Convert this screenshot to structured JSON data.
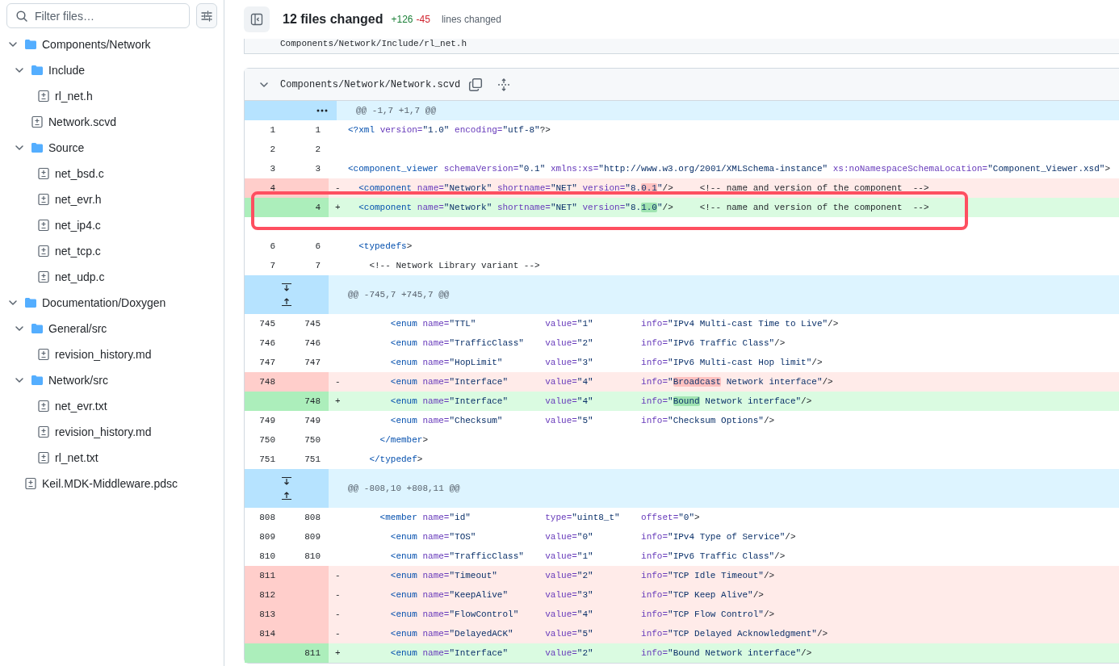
{
  "sidebar": {
    "filter": {
      "placeholder": "Filter files…"
    },
    "tree": [
      {
        "kind": "folder",
        "label": "Components/Network",
        "expanded": true,
        "children": [
          {
            "kind": "folder",
            "label": "Include",
            "expanded": true,
            "children": [
              {
                "kind": "file",
                "label": "rl_net.h"
              }
            ]
          },
          {
            "kind": "file",
            "label": "Network.scvd"
          },
          {
            "kind": "folder",
            "label": "Source",
            "expanded": true,
            "children": [
              {
                "kind": "file",
                "label": "net_bsd.c"
              },
              {
                "kind": "file",
                "label": "net_evr.h"
              },
              {
                "kind": "file",
                "label": "net_ip4.c"
              },
              {
                "kind": "file",
                "label": "net_tcp.c"
              },
              {
                "kind": "file",
                "label": "net_udp.c"
              }
            ]
          }
        ]
      },
      {
        "kind": "folder",
        "label": "Documentation/Doxygen",
        "expanded": true,
        "children": [
          {
            "kind": "folder",
            "label": "General/src",
            "expanded": true,
            "children": [
              {
                "kind": "file",
                "label": "revision_history.md"
              }
            ]
          },
          {
            "kind": "folder",
            "label": "Network/src",
            "expanded": true,
            "children": [
              {
                "kind": "file",
                "label": "net_evr.txt"
              },
              {
                "kind": "file",
                "label": "revision_history.md"
              },
              {
                "kind": "file",
                "label": "rl_net.txt"
              }
            ]
          }
        ]
      },
      {
        "kind": "file",
        "label": "Keil.MDK-Middleware.pdsc"
      }
    ]
  },
  "header": {
    "title": "12 files changed",
    "additions": "+126",
    "deletions": "-45",
    "suffix": "lines changed"
  },
  "previous_file": {
    "path": "Components/Network/Include/rl_net.h"
  },
  "file": {
    "path": "Components/Network/Network.scvd",
    "expanded": true,
    "lines": [
      {
        "kind": "hunk_top",
        "code": [
          [
            "@@ -1,7 +1,7 @@"
          ]
        ]
      },
      {
        "kind": "context",
        "old": "1",
        "new": "1",
        "code": [
          [
            "<?xml version=\"1.0\" encoding=\"utf-8\"?>"
          ]
        ]
      },
      {
        "kind": "context",
        "old": "2",
        "new": "2"
      },
      {
        "kind": "context",
        "old": "3",
        "new": "3",
        "code": [
          [
            "<component_viewer schemaVersion=\"0.1\" xmlns:xs=\"http://www.w3.org/2001/XMLSchema-instance\" xs:noNamespaceSchemaLocation=\"Component_Viewer.xsd\">"
          ]
        ]
      },
      {
        "kind": "del",
        "old": "4",
        "sign": "-",
        "code": [
          [
            "  <component name=\"Network\" shortname=\"NET\" version=\"8.",
            "0.1",
            "\"/>"
          ],
          [
            "<!-- name and version of the component  -->"
          ]
        ]
      },
      {
        "kind": "add",
        "new": "4",
        "sign": "+",
        "annotated": true,
        "code": [
          [
            "  <component name=\"Network\" shortname=\"NET\" version=\"8.",
            "1.0",
            "\"/>"
          ],
          [
            "<!-- name and version of the component  -->"
          ]
        ]
      },
      {
        "kind": "context"
      },
      {
        "kind": "context",
        "old": "6",
        "new": "6",
        "code": [
          [
            "  <typedefs>"
          ]
        ]
      },
      {
        "kind": "context",
        "old": "7",
        "new": "7",
        "code": [
          [
            "    <!-- Network Library variant -->"
          ]
        ]
      },
      {
        "kind": "hunk",
        "code": [
          [
            "@@ -745,7 +745,7 @@"
          ]
        ]
      },
      {
        "kind": "context",
        "old": "745",
        "new": "745",
        "code": [
          [
            "        <enum name=\"TTL\""
          ],
          [
            "value=\"1\""
          ],
          [
            "info=\"IPv4 Multi-cast Time to Live\"/>"
          ]
        ]
      },
      {
        "kind": "context",
        "old": "746",
        "new": "746",
        "code": [
          [
            "        <enum name=\"TrafficClass\""
          ],
          [
            "value=\"2\""
          ],
          [
            "info=\"IPv6 Traffic Class\"/>"
          ]
        ]
      },
      {
        "kind": "context",
        "old": "747",
        "new": "747",
        "code": [
          [
            "        <enum name=\"HopLimit\""
          ],
          [
            "value=\"3\""
          ],
          [
            "info=\"IPv6 Multi-cast Hop limit\"/>"
          ]
        ]
      },
      {
        "kind": "del",
        "old": "748",
        "sign": "-",
        "code": [
          [
            "        <enum name=\"Interface\""
          ],
          [
            "value=\"4\""
          ],
          [
            "info=\"",
            "Broadcast",
            " Network interface\"/>"
          ]
        ]
      },
      {
        "kind": "add",
        "new": "748",
        "sign": "+",
        "code": [
          [
            "        <enum name=\"Interface\""
          ],
          [
            "value=\"4\""
          ],
          [
            "info=\"",
            "Bound",
            " Network interface\"/>"
          ]
        ]
      },
      {
        "kind": "context",
        "old": "749",
        "new": "749",
        "code": [
          [
            "        <enum name=\"Checksum\""
          ],
          [
            "value=\"5\""
          ],
          [
            "info=\"Checksum Options\"/>"
          ]
        ]
      },
      {
        "kind": "context",
        "old": "750",
        "new": "750",
        "code": [
          [
            "      </member>"
          ]
        ]
      },
      {
        "kind": "context",
        "old": "751",
        "new": "751",
        "code": [
          [
            "    </typedef>"
          ]
        ]
      },
      {
        "kind": "hunk",
        "code": [
          [
            "@@ -808,10 +808,11 @@"
          ]
        ]
      },
      {
        "kind": "context",
        "old": "808",
        "new": "808",
        "code": [
          [
            "      <member name=\"id\""
          ],
          [
            "type=\"uint8_t\""
          ],
          [
            "offset=\"0\">"
          ]
        ]
      },
      {
        "kind": "context",
        "old": "809",
        "new": "809",
        "code": [
          [
            "        <enum name=\"TOS\""
          ],
          [
            "value=\"0\""
          ],
          [
            "info=\"IPv4 Type of Service\"/>"
          ]
        ]
      },
      {
        "kind": "context",
        "old": "810",
        "new": "810",
        "code": [
          [
            "        <enum name=\"TrafficClass\""
          ],
          [
            "value=\"1\""
          ],
          [
            "info=\"IPv6 Traffic Class\"/>"
          ]
        ]
      },
      {
        "kind": "del",
        "old": "811",
        "sign": "-",
        "code": [
          [
            "        <enum name=\"Timeout\""
          ],
          [
            "value=\"2\""
          ],
          [
            "info=\"TCP Idle Timeout\"/>"
          ]
        ]
      },
      {
        "kind": "del",
        "old": "812",
        "sign": "-",
        "code": [
          [
            "        <enum name=\"KeepAlive\""
          ],
          [
            "value=\"3\""
          ],
          [
            "info=\"TCP Keep Alive\"/>"
          ]
        ]
      },
      {
        "kind": "del",
        "old": "813",
        "sign": "-",
        "code": [
          [
            "        <enum name=\"FlowControl\""
          ],
          [
            "value=\"4\""
          ],
          [
            "info=\"TCP Flow Control\"/>"
          ]
        ]
      },
      {
        "kind": "del",
        "old": "814",
        "sign": "-",
        "code": [
          [
            "        <enum name=\"DelayedACK\""
          ],
          [
            "value=\"5\""
          ],
          [
            "info=\"TCP Delayed Acknowledgment\"/>"
          ]
        ]
      },
      {
        "kind": "add",
        "new": "811",
        "sign": "+",
        "code": [
          [
            "        <enum name=\"Interface\""
          ],
          [
            "value=\"2\""
          ],
          [
            "info=\"Bound Network interface\"/>"
          ]
        ]
      }
    ]
  }
}
